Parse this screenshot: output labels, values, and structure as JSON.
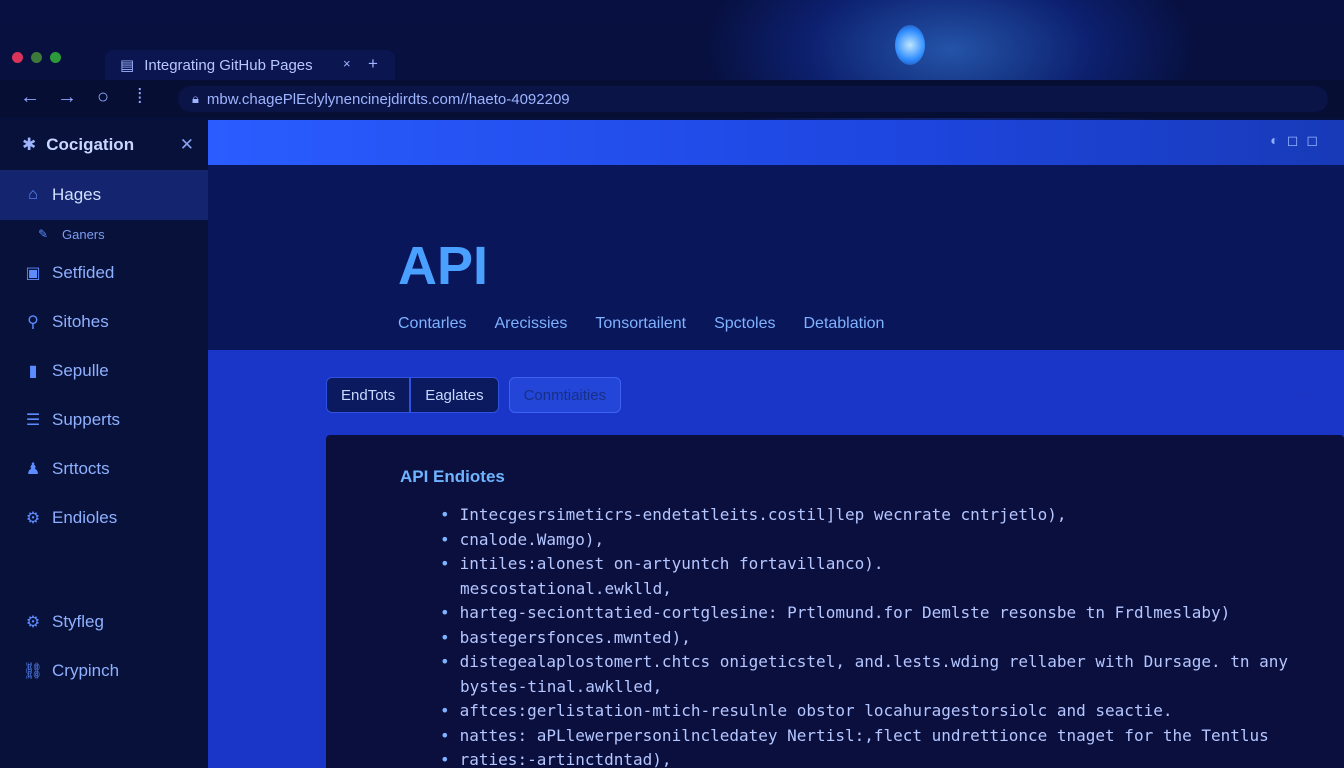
{
  "browser": {
    "tab_title": "Integrating GitHub Pages",
    "tab_icon": "page-icon",
    "tab_close": "×",
    "tab_new": "+",
    "url": "mbw.chagePlEclylynencinejdirdts.com//haeto-4092209",
    "nav_icons": [
      "back-arrow-icon",
      "forward-arrow-icon",
      "reload-icon",
      "reader-icon"
    ]
  },
  "sidebar": {
    "title": "Cocigation",
    "items": [
      {
        "label": "Hages",
        "icon": "home-icon",
        "active": true
      },
      {
        "label": "Ganers",
        "icon": "pencil-icon",
        "small": true
      },
      {
        "label": "Setfided",
        "icon": "briefcase-icon"
      },
      {
        "label": "Sitohes",
        "icon": "pin-icon"
      },
      {
        "label": "Sepulle",
        "icon": "chart-icon"
      },
      {
        "label": "Supperts",
        "icon": "list-icon"
      },
      {
        "label": "Srttocts",
        "icon": "person-icon"
      },
      {
        "label": "Endioles",
        "icon": "cog-search-icon"
      },
      {
        "label": "Styfleg",
        "icon": "gear-icon"
      },
      {
        "label": "Crypinch",
        "icon": "link-icon"
      }
    ]
  },
  "hero": {
    "title": "API",
    "nav": [
      "Contarles",
      "Arecissies",
      "Tonsortailent",
      "Spctoles",
      "Detablation"
    ]
  },
  "tabs": [
    "EndTots",
    "Eaglates",
    "Conmtiaities"
  ],
  "panel": {
    "title": "API Endiotes",
    "lines": [
      {
        "bullet": true,
        "text": "Intecgesrsimeticrs-endetatleits.costil]lep wecnrate cntrjetlo),"
      },
      {
        "bullet": true,
        "text": "cnalode.Wamgo),"
      },
      {
        "bullet": true,
        "text": "intiles:alonest on-artyuntch fortavillanco)."
      },
      {
        "bullet": false,
        "text": "mescostational.ewklld,"
      },
      {
        "bullet": true,
        "text": "harteg-secionttatied-cortglesine: Prtlomund.for Demlste resonsbe tn Frdlmeslaby)"
      },
      {
        "bullet": true,
        "text": "bastegersfonces.mwnted),"
      },
      {
        "bullet": true,
        "text": "distegealaplostomert.chtcs onigeticstel, and.lests.wding rellaber with Dursage. tn any"
      },
      {
        "bullet": false,
        "text": "bystes-tinal.awklled,"
      },
      {
        "bullet": true,
        "text": "aftces:gerlistation-mtich-resulnle obstor locahuragestorsiolc and seactie."
      },
      {
        "bullet": true,
        "text": "nattes: aPLlewerpersonilncledatey Nertisl:,flect undrettionce tnaget for the Tentlus"
      },
      {
        "bullet": true,
        "text": "raties:-artinctdntad),"
      }
    ]
  },
  "colors": {
    "accent": "#4aa0ff",
    "sidebar_bg": "#07113a",
    "panel_bg": "#0a0f3e"
  }
}
